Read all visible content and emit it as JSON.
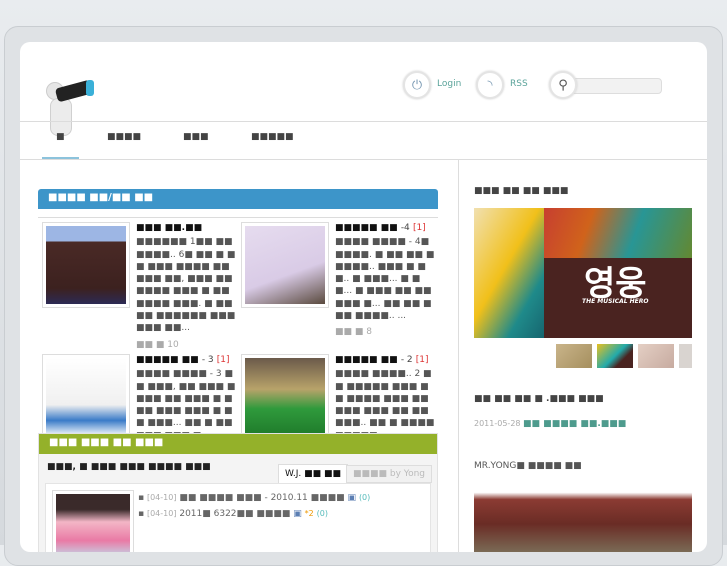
{
  "header": {
    "login": "Login",
    "rss": "RSS",
    "search_placeholder": ""
  },
  "nav": [
    "■",
    "■■■■",
    "■■■",
    "■■■■■"
  ],
  "left": {
    "section1_title": "■■■■ ■■/■■ ■■",
    "posts": [
      {
        "title": "■■■ ■■.■■",
        "count": "",
        "body": "■■■■■■ 1■■ ■■ ■■■■.. 6■ ■■ ■ ■■ ■■■ ■■■■ ■■ ■■■ ■■, ■■■ ■■ ■■■■ ■■■ ■ ■■ ■■■■ ■■■. ■ ■■■■ ■■■■■■ ■■■ ■■■ ■■...",
        "meta": "■■ ■",
        "meta_num": "10"
      },
      {
        "title": "■■■■■ ■■",
        "count": "-4",
        "comments": "[1]",
        "body": "■■■■ ■■■■ - 4■ ■■■■. ■ ■■ ■■ ■■■■■.. ■■■ ■ ■■.. ■ ■■■... ■ ■■... ■ ■■■ ■■ ■■ ■■■ ■... ■■ ■■ ■■■ ■■■■.. ...",
        "meta": "■■ ■",
        "meta_num": "8"
      },
      {
        "title": "■■■■■ ■■",
        "count": "- 3",
        "comments": "[1]",
        "body": "■■■■ ■■■■ - 3 ■■ ■■■, ■■ ■■■ ■■■■ ■■ ■■■ ■ ■■■ ■■■ ■■■ ■ ■■ ■■■... ■■ ■ ■■ ■■■ ■■■ ■"
      },
      {
        "title": "■■■■■ ■■",
        "count": "- 2",
        "comments": "[1]",
        "body": "■■■■ ■■■■.. 2 ■■ ■■■■■ ■■■ ■■ ■■■■ ■■■ ■■ ■■■ ■■■ ■■ ■■ ■■■.. ■■ ■ ■■■■ ■■■■■"
      }
    ],
    "section2_title": "■■■ ■■■ ■■ ■■■",
    "board_title": "■■■, ■ ■■■ ■■■ ■■■■ ■■■",
    "tabs": [
      {
        "label": "W.J. ■■ ■■"
      },
      {
        "label": "■■■■ by Yong"
      }
    ],
    "board_items": [
      {
        "date": "[04-10]",
        "text": "■■ ■■■■ ■■■ - 2010.11 ■■■■",
        "extra": "",
        "count": "(0)"
      },
      {
        "date": "[04-10]",
        "text": "2011■ 6322■■ ■■■■",
        "extra": "*2",
        "count": "(0)"
      }
    ]
  },
  "right": {
    "section1_title": "■■■ ■■ ■■ ■■■",
    "poster_text": "영웅",
    "poster_sub": "THE MUSICAL HERO",
    "section2_title": "■■ ■■ ■■ ■ .■■■ ■■■",
    "date": "2011-05-28",
    "link": "■■ ■■■■ ■■.■■■",
    "section3_title": "MR.YONG■ ■■■■ ■■"
  },
  "colors": {
    "blue": "#3d95c9",
    "green": "#94b12a",
    "teal": "#4e9b8d"
  }
}
